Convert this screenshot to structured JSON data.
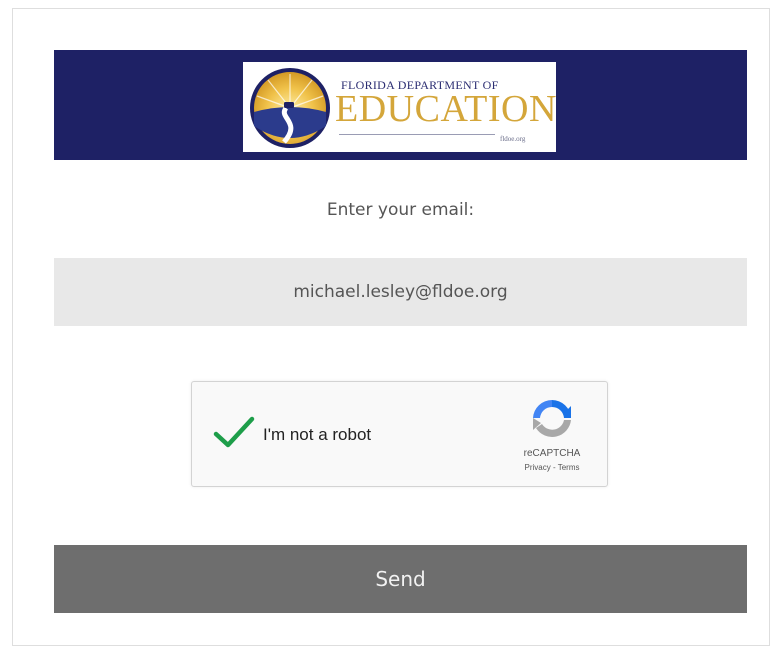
{
  "header": {
    "logo": {
      "org_line": "FLORIDA DEPARTMENT OF",
      "wordmark": "EDUCATION",
      "url": "fldoe.org",
      "banner_color": "#1e2165",
      "gold_color": "#d4a63a"
    }
  },
  "form": {
    "prompt": "Enter your email:",
    "email_value": "michael.lesley@fldoe.org",
    "captcha": {
      "label": "I'm not a robot",
      "checked": true,
      "brand": "reCAPTCHA",
      "privacy_link": "Privacy",
      "separator": " - ",
      "terms_link": "Terms",
      "check_color": "#1e9e4a"
    },
    "submit_label": "Send",
    "submit_color": "#6e6e6e"
  }
}
